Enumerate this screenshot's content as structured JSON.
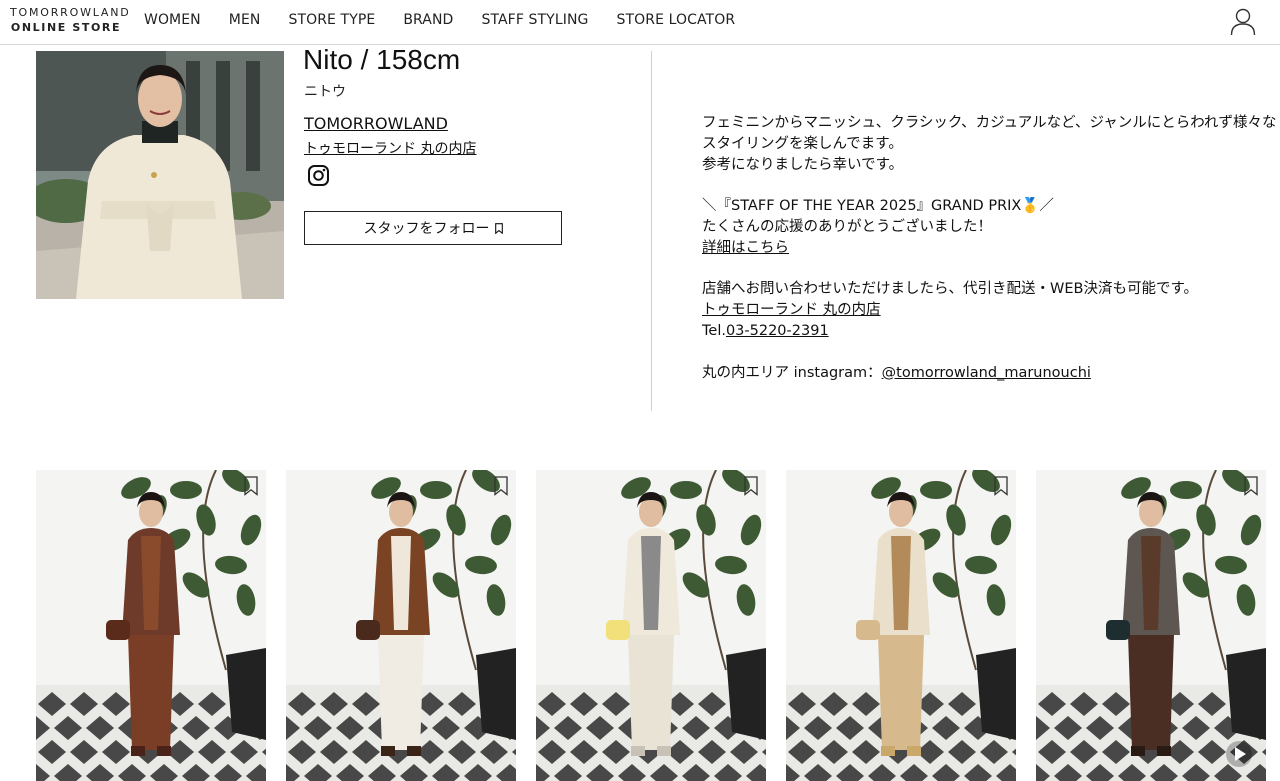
{
  "header": {
    "logo_top": "TOMORROWLAND",
    "logo_bottom": "ONLINE STORE",
    "nav": [
      "WOMEN",
      "MEN",
      "STORE TYPE",
      "BRAND",
      "STAFF STYLING",
      "STORE LOCATOR"
    ],
    "user_icon": "user-icon"
  },
  "profile": {
    "name": "Nito / 158cm",
    "kana": "ニトウ",
    "brand": "TOMORROWLAND",
    "shop": "トゥモローランド 丸の内店",
    "instagram_icon": "instagram-icon",
    "follow_label": "スタッフをフォロー",
    "follow_icon": "bookmark-icon"
  },
  "bio": {
    "line1": "フェミニンからマニッシュ、クラシック、カジュアルなど、ジャンルにとらわれず様々な",
    "line2": "スタイリングを楽しんでます。",
    "line3": "参考になりましたら幸いです。",
    "award": "＼『STAFF OF THE YEAR 2025』GRAND PRIX🥇／",
    "thanks": "たくさんの応援のありがとうございました！",
    "details_link": "詳細はこちら",
    "contact": "店舗へお問い合わせいただけましたら、代引き配送・WEB決済も可能です。",
    "shop_link": "トゥモローランド 丸の内店",
    "tel_prefix": "Tel.",
    "tel": "03-5220-2391",
    "insta_prefix": "丸の内エリア instagram：",
    "insta_handle": "@tomorrowland_marunouchi"
  },
  "gallery": [
    {
      "outfit": "brown tweed jacket, brown knit, brown pants, tall brown boots",
      "coat": "#6e3a2a",
      "inner": "#8a4a2c",
      "bottom": "#7a3e26",
      "shoes": "#4a2217",
      "bag": "#5a2a1a"
    },
    {
      "outfit": "brown boa long vest, cream knit, white skirt",
      "coat": "#7a4424",
      "inner": "#eee7da",
      "bottom": "#f0ece3",
      "shoes": "#3a2418",
      "bag": "#4a2a1c"
    },
    {
      "outfit": "cream double coat, grey hoodie, cream skirt, yellow bag",
      "coat": "#efe9dc",
      "inner": "#8a8a8a",
      "bottom": "#e9e3d6",
      "shoes": "#c8c2b6",
      "bag": "#f2e07a"
    },
    {
      "outfit": "beige quilted jacket, camel knit, beige pants",
      "coat": "#e9dfca",
      "inner": "#b38a5a",
      "bottom": "#d6b98c",
      "shoes": "#c9a86a",
      "bag": "#d6b98c"
    },
    {
      "outfit": "grey tweed coat, brown vest, brown skirt, black bag",
      "coat": "#5e5650",
      "inner": "#5a3a2a",
      "bottom": "#4a2e24",
      "shoes": "#2a1a14",
      "bag": "#1e2e30"
    }
  ],
  "play_icon": "play-icon"
}
